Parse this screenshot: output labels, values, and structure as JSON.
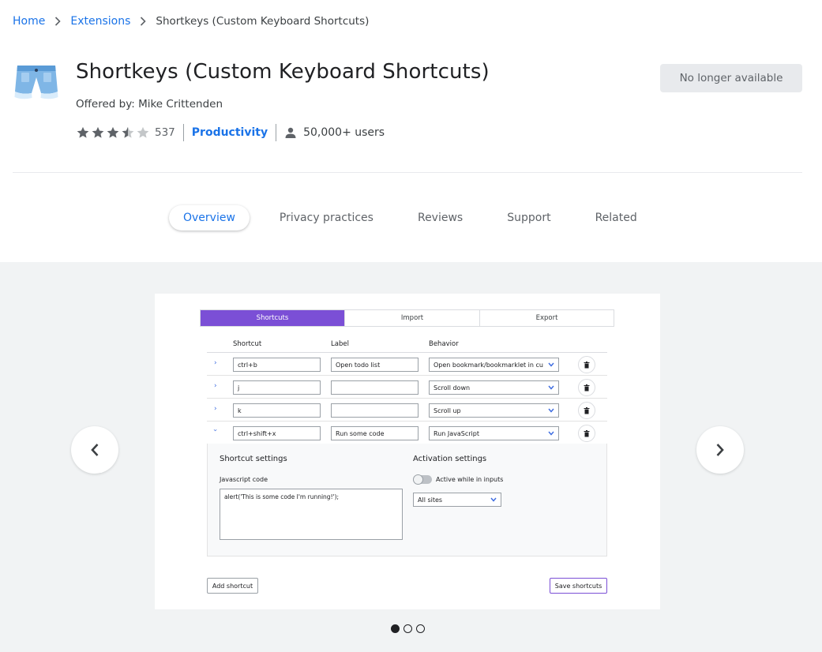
{
  "breadcrumb": {
    "home": "Home",
    "extensions": "Extensions",
    "current": "Shortkeys (Custom Keyboard Shortcuts)"
  },
  "extension": {
    "icon": "shorts-icon",
    "title": "Shortkeys (Custom Keyboard Shortcuts)",
    "offered_by": "Offered by: Mike Crittenden",
    "rating": 3.5,
    "rating_max": 5,
    "rating_count": "537",
    "category": "Productivity",
    "users": "50,000+ users",
    "status_button": "No longer available"
  },
  "tabs": [
    {
      "label": "Overview",
      "active": true
    },
    {
      "label": "Privacy practices",
      "active": false
    },
    {
      "label": "Reviews",
      "active": false
    },
    {
      "label": "Support",
      "active": false
    },
    {
      "label": "Related",
      "active": false
    }
  ],
  "gallery": {
    "slide_count": 3,
    "active_index": 0,
    "screenshot": {
      "tabs": [
        {
          "label": "Shortcuts",
          "active": true
        },
        {
          "label": "Import",
          "active": false
        },
        {
          "label": "Export",
          "active": false
        }
      ],
      "headers": {
        "shortcut": "Shortcut",
        "label": "Label",
        "behavior": "Behavior"
      },
      "rows": [
        {
          "shortcut": "ctrl+b",
          "label": "Open todo list",
          "behavior": "Open bookmark/bookmarklet in cu",
          "expanded": false
        },
        {
          "shortcut": "j",
          "label": "",
          "behavior": "Scroll down",
          "expanded": false
        },
        {
          "shortcut": "k",
          "label": "",
          "behavior": "Scroll up",
          "expanded": false
        },
        {
          "shortcut": "ctrl+shift+x",
          "label": "Run some code",
          "behavior": "Run JavaScript",
          "expanded": true
        }
      ],
      "settings": {
        "shortcut_settings_title": "Shortcut settings",
        "js_code_label": "Javascript code",
        "js_code": "alert('This is some code I'm running!');",
        "activation_title": "Activation settings",
        "active_in_inputs_label": "Active while in inputs",
        "active_in_inputs": false,
        "sites_value": "All sites"
      },
      "add_button": "Add shortcut",
      "save_button": "Save shortcuts"
    }
  },
  "colors": {
    "link": "#1a73e8",
    "accent": "#7b4fd6",
    "gallery_bg": "#f1f3f4",
    "status_bg": "#e8eaed"
  }
}
